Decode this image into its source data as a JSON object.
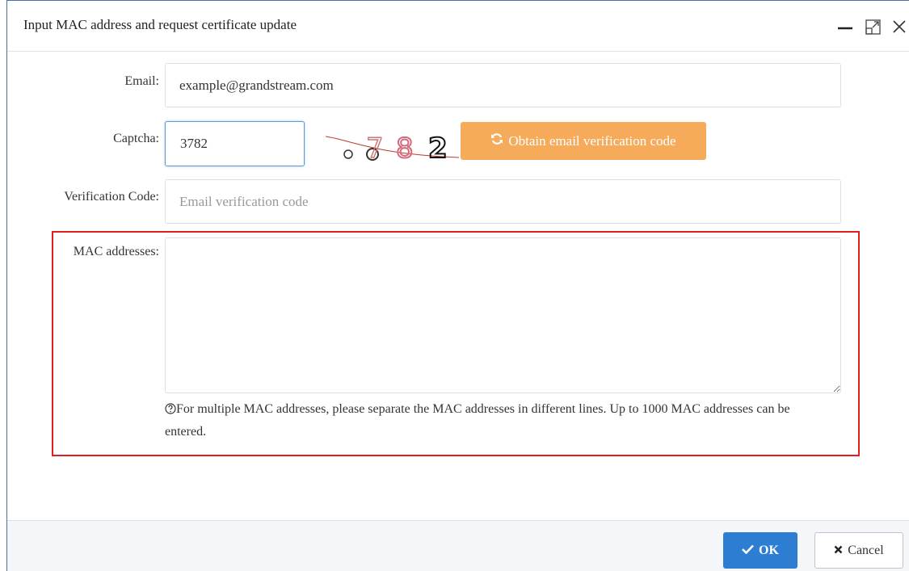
{
  "dialog": {
    "title": "Input MAC address and request certificate update"
  },
  "form": {
    "email": {
      "label": "Email:",
      "value": "example@grandstream.com"
    },
    "captcha": {
      "label": "Captcha:",
      "value": "3782",
      "image_text": "7 8 2",
      "obtain_label": "Obtain email verification code"
    },
    "verification": {
      "label": "Verification Code:",
      "placeholder": "Email verification code"
    },
    "mac": {
      "label": "MAC addresses:",
      "value": "",
      "hint": "For multiple MAC addresses, please separate the MAC addresses in different lines. Up to 1000 MAC addresses can be entered."
    }
  },
  "footer": {
    "ok_label": "OK",
    "cancel_label": "Cancel"
  },
  "colors": {
    "accent_orange": "#f6ab5a",
    "primary_blue": "#2d7dd2",
    "highlight_red": "#e02020"
  },
  "icons": {
    "minimize": "minimize-icon",
    "maximize": "maximize-icon",
    "close": "close-icon",
    "refresh": "refresh-icon",
    "help": "help-circle-icon",
    "check": "check-icon",
    "cross": "cross-icon",
    "resize": "resize-handle-icon"
  }
}
